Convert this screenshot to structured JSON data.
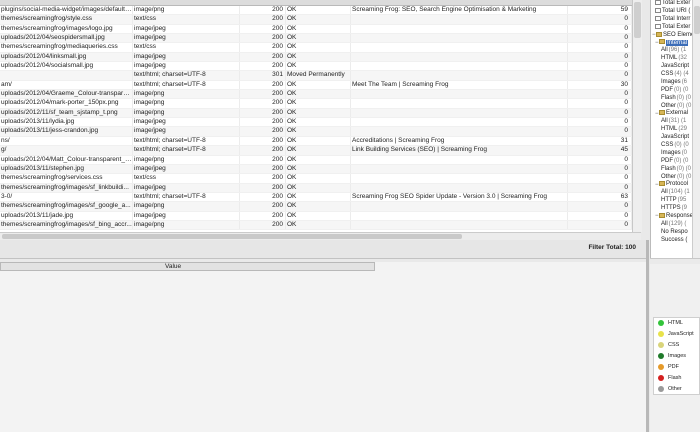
{
  "table": {
    "rows": [
      {
        "address": "plugins/social-media-widget/images/default/...",
        "content_type": "image/png",
        "code": "200",
        "status": "OK",
        "title": "Screaming Frog: SEO, Search Engine Optimisation & Marketing",
        "num": "59"
      },
      {
        "address": "themes/screamingfrog/style.css",
        "content_type": "text/css",
        "code": "200",
        "status": "OK",
        "title": "",
        "num": "0"
      },
      {
        "address": "themes/screamingfrog/images/logo.jpg",
        "content_type": "image/jpeg",
        "code": "200",
        "status": "OK",
        "title": "",
        "num": "0"
      },
      {
        "address": "uploads/2012/04/seospidersmall.jpg",
        "content_type": "image/jpeg",
        "code": "200",
        "status": "OK",
        "title": "",
        "num": "0"
      },
      {
        "address": "themes/screamingfrog/mediaqueries.css",
        "content_type": "text/css",
        "code": "200",
        "status": "OK",
        "title": "",
        "num": "0"
      },
      {
        "address": "uploads/2012/04/linksmall.jpg",
        "content_type": "image/jpeg",
        "code": "200",
        "status": "OK",
        "title": "",
        "num": "0"
      },
      {
        "address": "uploads/2012/04/socialsmall.jpg",
        "content_type": "image/jpeg",
        "code": "200",
        "status": "OK",
        "title": "",
        "num": "0"
      },
      {
        "address": "",
        "content_type": "text/html; charset=UTF-8",
        "code": "301",
        "status": "Moved Permanently",
        "title": "",
        "num": "0"
      },
      {
        "address": "am/",
        "content_type": "text/html; charset=UTF-8",
        "code": "200",
        "status": "OK",
        "title": "Meet The Team | Screaming Frog",
        "num": "30"
      },
      {
        "address": "uploads/2012/04/Graeme_Colour-transpare...",
        "content_type": "image/png",
        "code": "200",
        "status": "OK",
        "title": "",
        "num": "0"
      },
      {
        "address": "uploads/2012/04/mark-porter_150px.png",
        "content_type": "image/png",
        "code": "200",
        "status": "OK",
        "title": "",
        "num": "0"
      },
      {
        "address": "uploads/2012/11/sf_team_sjstamp_t.png",
        "content_type": "image/png",
        "code": "200",
        "status": "OK",
        "title": "",
        "num": "0"
      },
      {
        "address": "uploads/2013/11/lydia.jpg",
        "content_type": "image/jpeg",
        "code": "200",
        "status": "OK",
        "title": "",
        "num": "0"
      },
      {
        "address": "uploads/2013/11/jess-crandon.jpg",
        "content_type": "image/jpeg",
        "code": "200",
        "status": "OK",
        "title": "",
        "num": "0"
      },
      {
        "address": "ns/",
        "content_type": "text/html; charset=UTF-8",
        "code": "200",
        "status": "OK",
        "title": "Accreditations | Screaming Frog",
        "num": "31"
      },
      {
        "address": "g/",
        "content_type": "text/html; charset=UTF-8",
        "code": "200",
        "status": "OK",
        "title": "Link Building Services (SEO) | Screaming Frog",
        "num": "45"
      },
      {
        "address": "uploads/2012/04/Matt_Colour-transparent_1...",
        "content_type": "image/png",
        "code": "200",
        "status": "OK",
        "title": "",
        "num": "0"
      },
      {
        "address": "uploads/2013/11/stephen.jpg",
        "content_type": "image/jpeg",
        "code": "200",
        "status": "OK",
        "title": "",
        "num": "0"
      },
      {
        "address": "themes/screamingfrog/services.css",
        "content_type": "text/css",
        "code": "200",
        "status": "OK",
        "title": "",
        "num": "0"
      },
      {
        "address": "themes/screamingfrog/images/sf_linkbuildi...",
        "content_type": "image/jpeg",
        "code": "200",
        "status": "OK",
        "title": "",
        "num": "0"
      },
      {
        "address": "3-0/",
        "content_type": "text/html; charset=UTF-8",
        "code": "200",
        "status": "OK",
        "title": "Screaming Frog SEO Spider Update - Version 3.0 | Screaming Frog",
        "num": "63"
      },
      {
        "address": "themes/screamingfrog/images/sf_google_a...",
        "content_type": "image/png",
        "code": "200",
        "status": "OK",
        "title": "",
        "num": "0"
      },
      {
        "address": "uploads/2013/11/jade.jpg",
        "content_type": "image/jpeg",
        "code": "200",
        "status": "OK",
        "title": "",
        "num": "0"
      },
      {
        "address": "themes/screamingfrog/images/sf_bing_accr...",
        "content_type": "image/png",
        "code": "200",
        "status": "OK",
        "title": "",
        "num": "0"
      }
    ]
  },
  "filter": {
    "total": "Filter Total:  100"
  },
  "details": {
    "value_header": "Value"
  },
  "tree": {
    "items": [
      {
        "label": "Total Exter",
        "kind": "doc",
        "indent": 1
      },
      {
        "label": "Total URI (",
        "kind": "doc",
        "indent": 1
      },
      {
        "label": "Total Interr",
        "kind": "doc",
        "indent": 1
      },
      {
        "label": "Total Exter",
        "kind": "doc",
        "indent": 1
      },
      {
        "label": "SEO Elements",
        "kind": "folder",
        "indent": 0,
        "toggle": "−"
      },
      {
        "label": "Internal",
        "kind": "folder",
        "indent": 1,
        "toggle": "−",
        "selected": true
      },
      {
        "label": "All",
        "count": "(96) (1",
        "indent": 3
      },
      {
        "label": "HTML",
        "count": "(32",
        "indent": 3
      },
      {
        "label": "JavaScript",
        "count": "",
        "indent": 3
      },
      {
        "label": "CSS",
        "count": "(4) (4",
        "indent": 3
      },
      {
        "label": "Images",
        "count": "(6",
        "indent": 3
      },
      {
        "label": "PDF",
        "count": "(0) (0",
        "indent": 3
      },
      {
        "label": "Flash",
        "count": "(0) (0",
        "indent": 3
      },
      {
        "label": "Other",
        "count": "(0) (0",
        "indent": 3
      },
      {
        "label": "External",
        "kind": "folder",
        "indent": 1,
        "toggle": "−"
      },
      {
        "label": "All",
        "count": "(31) (1",
        "indent": 3
      },
      {
        "label": "HTML",
        "count": "(29",
        "indent": 3
      },
      {
        "label": "JavaScript",
        "count": "",
        "indent": 3
      },
      {
        "label": "CSS",
        "count": "(0) (0",
        "indent": 3
      },
      {
        "label": "Images",
        "count": "(0",
        "indent": 3
      },
      {
        "label": "PDF",
        "count": "(0) (0",
        "indent": 3
      },
      {
        "label": "Flash",
        "count": "(0) (0",
        "indent": 3
      },
      {
        "label": "Other",
        "count": "(0) (0",
        "indent": 3
      },
      {
        "label": "Protocol",
        "kind": "folder",
        "indent": 1,
        "toggle": "−"
      },
      {
        "label": "All",
        "count": "(104) (1",
        "indent": 3
      },
      {
        "label": "HTTP",
        "count": "(95",
        "indent": 3
      },
      {
        "label": "HTTPS",
        "count": "(9",
        "indent": 3
      },
      {
        "label": "Response",
        "kind": "folder",
        "indent": 1,
        "toggle": "−"
      },
      {
        "label": "All",
        "count": "(129) (",
        "indent": 3
      },
      {
        "label": "No Respo",
        "count": "",
        "indent": 3
      },
      {
        "label": "Success (",
        "count": "",
        "indent": 3
      }
    ]
  },
  "legend": {
    "items": [
      {
        "label": "HTML",
        "color": "#33c43a"
      },
      {
        "label": "JavaScript",
        "color": "#e8e24a"
      },
      {
        "label": "CSS",
        "color": "#d9d47a"
      },
      {
        "label": "Images",
        "color": "#1f7a2a"
      },
      {
        "label": "PDF",
        "color": "#e59a2a"
      },
      {
        "label": "Flash",
        "color": "#d42020"
      },
      {
        "label": "Other",
        "color": "#9a9a9a"
      }
    ]
  }
}
